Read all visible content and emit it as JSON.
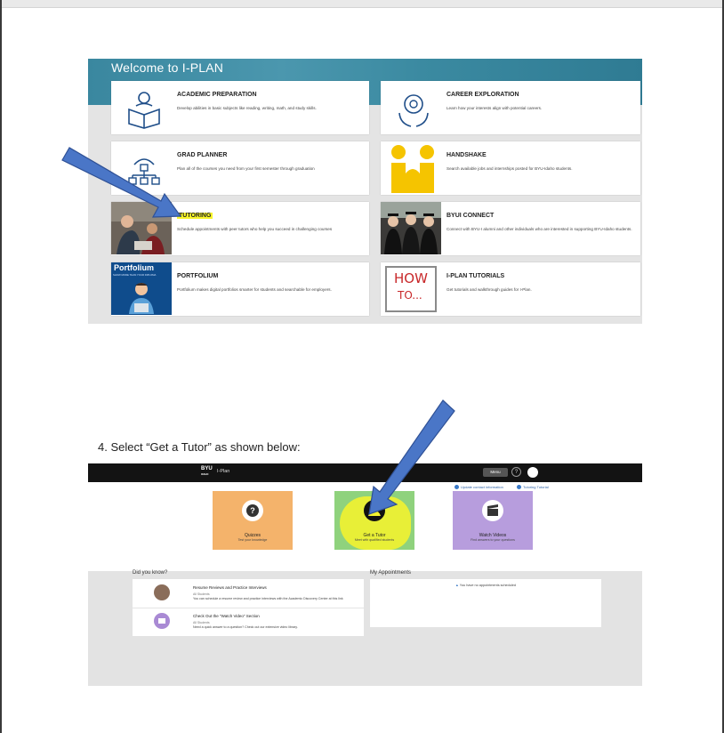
{
  "welcome": {
    "title": "Welcome to I-PLAN",
    "cards": [
      {
        "title": "ACADEMIC PREPARATION",
        "desc": "Develop abilities in basic subjects like reading, writing, math, and study skills.",
        "icon": "book-person-icon"
      },
      {
        "title": "CAREER EXPLORATION",
        "desc": "Learn how your interests align with potential careers.",
        "icon": "brain-hands-icon"
      },
      {
        "title": "GRAD PLANNER",
        "desc": "Plan all of the courses you need from your first semester through graduation",
        "icon": "network-icon"
      },
      {
        "title": "HANDSHAKE",
        "desc": "Search available jobs and internships posted for BYU-Idaho students.",
        "icon": "handshake-logo"
      },
      {
        "title": "TUTORING",
        "desc": "Schedule appointments with peer tutors who help you succeed in challenging courses",
        "icon": "tutoring-photo"
      },
      {
        "title": "BYUI CONNECT",
        "desc": "Connect with BYU-I alumni and other individuals who are interested in supporting BYU-Idaho students.",
        "icon": "graduates-photo"
      },
      {
        "title": "PORTFOLIUM",
        "desc": "Portfolium makes digital portfolios smarter for students and searchable for employers.",
        "icon": "portfolium-logo"
      },
      {
        "title": "I-PLAN TUTORIALS",
        "desc": "Get tutorials and walkthrough guides for I-Plan.",
        "icon": "how-to-sign"
      }
    ],
    "portfolium_logo_text": "Portfolium",
    "portfolium_tagline": "SHOW MORE THAN YOUR DIPLOMA",
    "howto_line1": "HOW",
    "howto_line2": "TO..."
  },
  "step": {
    "text": "4.   Select “Get a Tutor” as shown below:"
  },
  "tutor_page": {
    "logo": "BYU",
    "logo_sub": "IDAHO",
    "app_name": "I-Plan",
    "menu_label": "Menu",
    "help": "?",
    "links": [
      "Update contact information",
      "Tutoring Tutorial"
    ],
    "tiles": [
      {
        "title": "Quizzes",
        "sub": "Test your knowledge",
        "color": "#f4b36b",
        "icon": "question-icon"
      },
      {
        "title": "Get a Tutor",
        "sub": "Meet with qualified students",
        "color": "#8fd27d",
        "icon": "tutor-icon"
      },
      {
        "title": "Watch Videos",
        "sub": "Find answers to your questions",
        "color": "#b79ddd",
        "icon": "clapper-icon"
      }
    ],
    "did_you_know": {
      "heading": "Did you know?",
      "items": [
        {
          "title": "Resume Reviews and Practice Interviews",
          "audience": "All Students",
          "text": "You can schedule a resume review and practice interviews with the Academic Discovery Center at this link"
        },
        {
          "title": "Check Out the \"Watch Video\" Section",
          "audience": "All Students",
          "text": "Need a quick answer to a question? Check out our extensive video library."
        }
      ]
    },
    "appointments": {
      "heading": "My Appointments",
      "empty": "You have no appointments scheduled"
    }
  },
  "colors": {
    "arrow": "#4a76c7",
    "highlight_yellow": "#f7f52a",
    "banner_teal": "#3a879f"
  }
}
